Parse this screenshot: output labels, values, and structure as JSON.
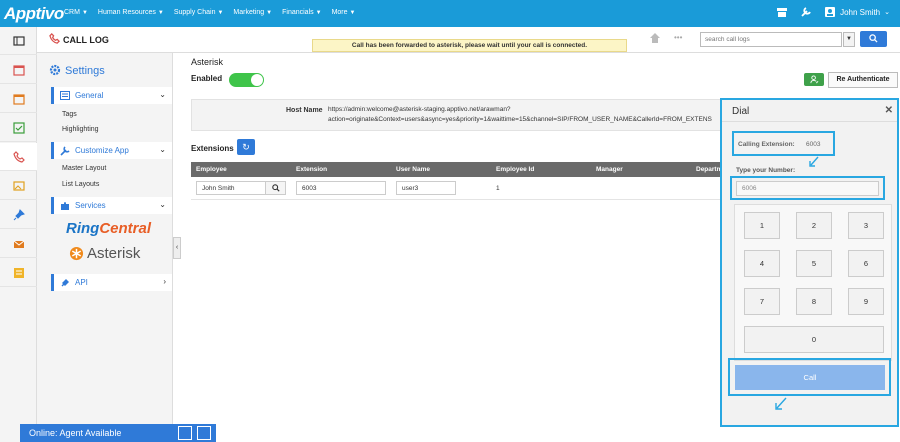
{
  "brand": {
    "logo": "Apptivo"
  },
  "nav": {
    "items": [
      "CRM",
      "Human Resources",
      "Supply Chain",
      "Marketing",
      "Financials",
      "More"
    ],
    "user": "John Smith"
  },
  "header": {
    "title": "CALL LOG",
    "notice": "Call has been forwarded to asterisk, please wait until your call is connected.",
    "search_placeholder": "search call logs"
  },
  "sidebar": {
    "title": "Settings",
    "general": {
      "label": "General",
      "items": [
        "Tags",
        "Highlighting"
      ]
    },
    "customize": {
      "label": "Customize App",
      "items": [
        "Master Layout",
        "List Layouts"
      ]
    },
    "services": {
      "label": "Services"
    },
    "ringcentral": {
      "ring": "Ring",
      "central": "Central"
    },
    "asterisk_logo": "Asterisk",
    "api": {
      "label": "API"
    }
  },
  "main": {
    "section_title": "Asterisk",
    "enabled_label": "Enabled",
    "reauth_label": "Re Authenticate",
    "host_label": "Host Name",
    "host_line1": "https://admin:welcome@asterisk-staging.apptivo.net/arawman?",
    "host_line2": "action=originate&Context=users&async=yes&priority=1&waittime=15&channel=SIP/FROM_USER_NAME&CallerId=FROM_EXTENS",
    "extensions_label": "Extensions",
    "columns": [
      "Employee",
      "Extension",
      "User Name",
      "Employee Id",
      "Manager",
      "Departm"
    ],
    "row": {
      "employee": "John Smith",
      "extension": "6003",
      "username": "user3",
      "employee_id": "1"
    }
  },
  "dial": {
    "title": "Dial",
    "calling_label": "Calling Extension:",
    "calling_value": "6003",
    "type_label": "Type your Number:",
    "number_value": "6006",
    "keys": [
      "1",
      "2",
      "3",
      "4",
      "5",
      "6",
      "7",
      "8",
      "9"
    ],
    "zero": "0",
    "call_label": "Call"
  },
  "status": {
    "text": "Online: Agent Available"
  },
  "colors": {
    "brand": "#1a9bd8",
    "accent": "#2f7ad8",
    "highlight": "#29a7e1",
    "toggle": "#3fc44a"
  }
}
